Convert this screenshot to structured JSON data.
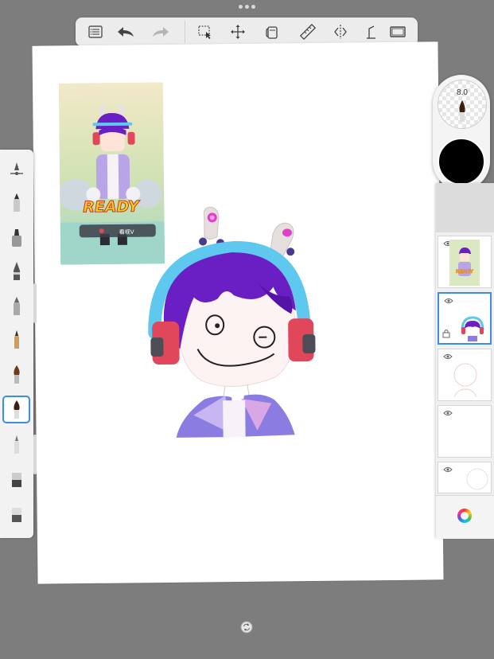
{
  "toolbar": {
    "items": [
      {
        "name": "layers-list",
        "icon": "list-icon"
      },
      {
        "name": "undo",
        "icon": "undo-arrow-icon"
      },
      {
        "name": "redo",
        "icon": "redo-arrow-icon"
      },
      {
        "name": "selection",
        "icon": "selection-icon"
      },
      {
        "name": "transform",
        "icon": "move-icon"
      },
      {
        "name": "fill",
        "icon": "bucket-icon"
      },
      {
        "name": "ruler",
        "icon": "ruler-icon"
      },
      {
        "name": "symmetry",
        "icon": "symmetry-icon"
      },
      {
        "name": "perspective",
        "icon": "perspective-icon"
      },
      {
        "name": "fullscreen",
        "icon": "frame-icon"
      }
    ]
  },
  "brushes": {
    "items": [
      {
        "name": "brush-settings",
        "icon": "brush-settings-icon"
      },
      {
        "name": "pencil",
        "icon": "pencil-icon"
      },
      {
        "name": "marker",
        "icon": "marker-icon"
      },
      {
        "name": "pen",
        "icon": "pen-icon"
      },
      {
        "name": "airbrush",
        "icon": "airbrush-icon"
      },
      {
        "name": "ink-pen",
        "icon": "ink-pen-icon"
      },
      {
        "name": "paintbrush",
        "icon": "paintbrush-icon"
      },
      {
        "name": "selected-brush",
        "icon": "paintbrush-icon",
        "selected": true
      },
      {
        "name": "smudge",
        "icon": "smudge-icon"
      },
      {
        "name": "eraser",
        "icon": "eraser-icon"
      },
      {
        "name": "hard-eraser",
        "icon": "eraser-icon"
      }
    ]
  },
  "puck": {
    "size_label": "8.0",
    "color": "#000000"
  },
  "reference": {
    "banner": "READY",
    "badge": "看视V"
  },
  "layers": {
    "items": [
      {
        "name": "layer-reference",
        "visible": true,
        "selected": false
      },
      {
        "name": "layer-color",
        "visible": true,
        "selected": true
      },
      {
        "name": "layer-sketch",
        "visible": true,
        "selected": false
      },
      {
        "name": "layer-blank",
        "visible": true,
        "selected": false
      },
      {
        "name": "layer-circle",
        "visible": true,
        "selected": false
      }
    ]
  },
  "colors": {
    "accent": "#3a8ee6",
    "hair": "#6a1fc4",
    "headphone": "#5fc8ef",
    "muff": "#e0475a",
    "jacket": "#8a7ce0"
  }
}
